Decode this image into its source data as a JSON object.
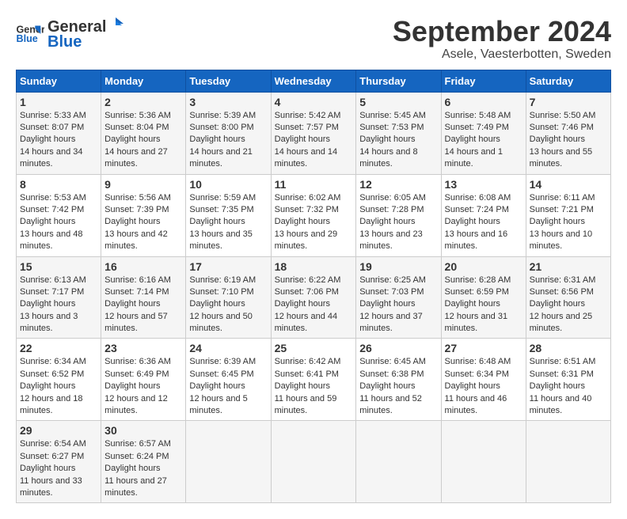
{
  "logo": {
    "text_general": "General",
    "text_blue": "Blue"
  },
  "header": {
    "month": "September 2024",
    "location": "Asele, Vaesterbotten, Sweden"
  },
  "days_of_week": [
    "Sunday",
    "Monday",
    "Tuesday",
    "Wednesday",
    "Thursday",
    "Friday",
    "Saturday"
  ],
  "weeks": [
    [
      {
        "day": 1,
        "sunrise": "5:33 AM",
        "sunset": "8:07 PM",
        "daylight": "14 hours and 34 minutes."
      },
      {
        "day": 2,
        "sunrise": "5:36 AM",
        "sunset": "8:04 PM",
        "daylight": "14 hours and 27 minutes."
      },
      {
        "day": 3,
        "sunrise": "5:39 AM",
        "sunset": "8:00 PM",
        "daylight": "14 hours and 21 minutes."
      },
      {
        "day": 4,
        "sunrise": "5:42 AM",
        "sunset": "7:57 PM",
        "daylight": "14 hours and 14 minutes."
      },
      {
        "day": 5,
        "sunrise": "5:45 AM",
        "sunset": "7:53 PM",
        "daylight": "14 hours and 8 minutes."
      },
      {
        "day": 6,
        "sunrise": "5:48 AM",
        "sunset": "7:49 PM",
        "daylight": "14 hours and 1 minute."
      },
      {
        "day": 7,
        "sunrise": "5:50 AM",
        "sunset": "7:46 PM",
        "daylight": "13 hours and 55 minutes."
      }
    ],
    [
      {
        "day": 8,
        "sunrise": "5:53 AM",
        "sunset": "7:42 PM",
        "daylight": "13 hours and 48 minutes."
      },
      {
        "day": 9,
        "sunrise": "5:56 AM",
        "sunset": "7:39 PM",
        "daylight": "13 hours and 42 minutes."
      },
      {
        "day": 10,
        "sunrise": "5:59 AM",
        "sunset": "7:35 PM",
        "daylight": "13 hours and 35 minutes."
      },
      {
        "day": 11,
        "sunrise": "6:02 AM",
        "sunset": "7:32 PM",
        "daylight": "13 hours and 29 minutes."
      },
      {
        "day": 12,
        "sunrise": "6:05 AM",
        "sunset": "7:28 PM",
        "daylight": "13 hours and 23 minutes."
      },
      {
        "day": 13,
        "sunrise": "6:08 AM",
        "sunset": "7:24 PM",
        "daylight": "13 hours and 16 minutes."
      },
      {
        "day": 14,
        "sunrise": "6:11 AM",
        "sunset": "7:21 PM",
        "daylight": "13 hours and 10 minutes."
      }
    ],
    [
      {
        "day": 15,
        "sunrise": "6:13 AM",
        "sunset": "7:17 PM",
        "daylight": "13 hours and 3 minutes."
      },
      {
        "day": 16,
        "sunrise": "6:16 AM",
        "sunset": "7:14 PM",
        "daylight": "12 hours and 57 minutes."
      },
      {
        "day": 17,
        "sunrise": "6:19 AM",
        "sunset": "7:10 PM",
        "daylight": "12 hours and 50 minutes."
      },
      {
        "day": 18,
        "sunrise": "6:22 AM",
        "sunset": "7:06 PM",
        "daylight": "12 hours and 44 minutes."
      },
      {
        "day": 19,
        "sunrise": "6:25 AM",
        "sunset": "7:03 PM",
        "daylight": "12 hours and 37 minutes."
      },
      {
        "day": 20,
        "sunrise": "6:28 AM",
        "sunset": "6:59 PM",
        "daylight": "12 hours and 31 minutes."
      },
      {
        "day": 21,
        "sunrise": "6:31 AM",
        "sunset": "6:56 PM",
        "daylight": "12 hours and 25 minutes."
      }
    ],
    [
      {
        "day": 22,
        "sunrise": "6:34 AM",
        "sunset": "6:52 PM",
        "daylight": "12 hours and 18 minutes."
      },
      {
        "day": 23,
        "sunrise": "6:36 AM",
        "sunset": "6:49 PM",
        "daylight": "12 hours and 12 minutes."
      },
      {
        "day": 24,
        "sunrise": "6:39 AM",
        "sunset": "6:45 PM",
        "daylight": "12 hours and 5 minutes."
      },
      {
        "day": 25,
        "sunrise": "6:42 AM",
        "sunset": "6:41 PM",
        "daylight": "11 hours and 59 minutes."
      },
      {
        "day": 26,
        "sunrise": "6:45 AM",
        "sunset": "6:38 PM",
        "daylight": "11 hours and 52 minutes."
      },
      {
        "day": 27,
        "sunrise": "6:48 AM",
        "sunset": "6:34 PM",
        "daylight": "11 hours and 46 minutes."
      },
      {
        "day": 28,
        "sunrise": "6:51 AM",
        "sunset": "6:31 PM",
        "daylight": "11 hours and 40 minutes."
      }
    ],
    [
      {
        "day": 29,
        "sunrise": "6:54 AM",
        "sunset": "6:27 PM",
        "daylight": "11 hours and 33 minutes."
      },
      {
        "day": 30,
        "sunrise": "6:57 AM",
        "sunset": "6:24 PM",
        "daylight": "11 hours and 27 minutes."
      },
      null,
      null,
      null,
      null,
      null
    ]
  ]
}
